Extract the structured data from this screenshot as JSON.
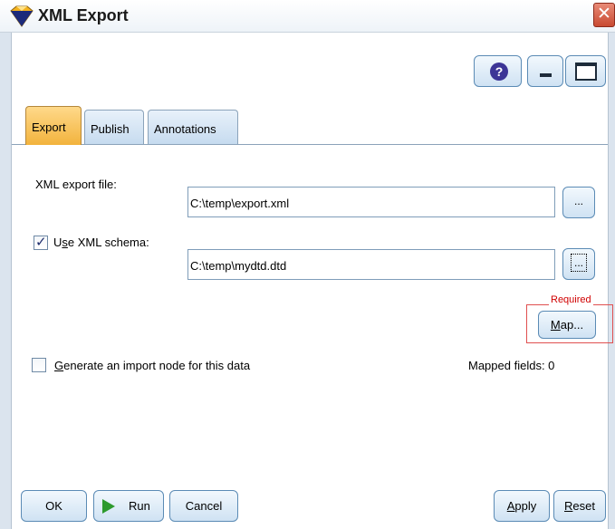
{
  "window": {
    "title": "XML Export",
    "close_glyph": "✕"
  },
  "toolbar": {
    "help_glyph": "?",
    "help_icon": "help-icon",
    "minimize_icon": "minimize-icon",
    "maximize_icon": "maximize-icon"
  },
  "tabs": [
    {
      "label": "Export",
      "active": true
    },
    {
      "label": "Publish",
      "active": false
    },
    {
      "label": "Annotations",
      "active": false
    }
  ],
  "form": {
    "xml_export_label": "XML export file:",
    "xml_export_value": "C:\\temp\\export.xml",
    "browse_label": "...",
    "use_schema_label_prefix": "U",
    "use_schema_label_mnemonic": "s",
    "use_schema_label_suffix": "e XML schema:",
    "use_schema_checked": true,
    "schema_value": "C:\\temp\\mydtd.dtd",
    "required_label": "Required",
    "map_label_mnemonic": "M",
    "map_label_suffix": "ap...",
    "generate_label_mnemonic": "G",
    "generate_label_suffix": "enerate an import node for this data",
    "generate_checked": false,
    "mapped_fields": "Mapped fields: 0"
  },
  "buttons": {
    "ok": "OK",
    "run": "Run",
    "cancel": "Cancel",
    "apply_mnemonic": "A",
    "apply_suffix": "pply",
    "reset_mnemonic": "R",
    "reset_suffix": "eset"
  },
  "colors": {
    "active_tab": "#f2b33d",
    "required_border": "#e05050",
    "run_icon": "#2d9a2d"
  }
}
